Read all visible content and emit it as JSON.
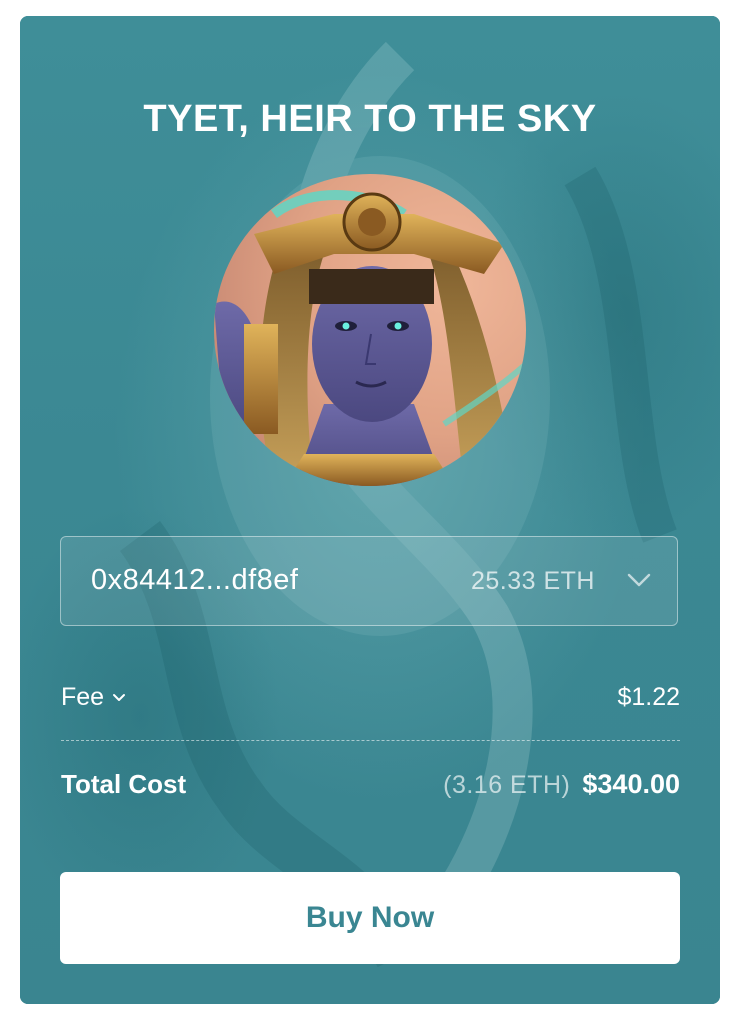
{
  "card": {
    "title": "TYET, HEIR TO THE SKY",
    "background_color": "#3b8893"
  },
  "avatar": {
    "icon": "character-portrait-image"
  },
  "wallet": {
    "address": "0x84412...df8ef",
    "balance": "25.33 ETH",
    "icon": "chevron-down-icon"
  },
  "fee": {
    "label": "Fee",
    "value": "$1.22",
    "icon": "chevron-down-icon"
  },
  "total": {
    "label": "Total Cost",
    "eth": "(3.16 ETH)",
    "usd": "$340.00"
  },
  "actions": {
    "buy_label": "Buy Now",
    "buy_text_color": "#3a8692"
  }
}
